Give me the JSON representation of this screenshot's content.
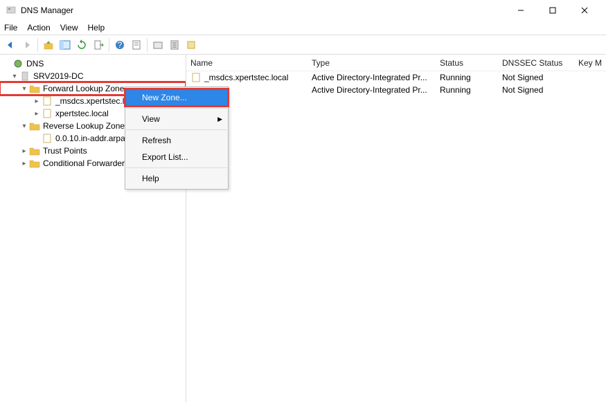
{
  "window": {
    "title": "DNS Manager"
  },
  "menu": {
    "file": "File",
    "action": "Action",
    "view": "View",
    "help": "Help"
  },
  "tree": {
    "root": "DNS",
    "server": "SRV2019-DC",
    "fwd": "Forward Lookup Zones",
    "fwd_children": {
      "z1": "_msdcs.xpertstec.local",
      "z2": "xpertstec.local"
    },
    "rev": "Reverse Lookup Zones",
    "rev_children": {
      "z1": "0.0.10.in-addr.arpa"
    },
    "trust": "Trust Points",
    "cond": "Conditional Forwarders"
  },
  "columns": {
    "name": "Name",
    "type": "Type",
    "status": "Status",
    "dnssec": "DNSSEC Status",
    "keym": "Key M"
  },
  "rows": [
    {
      "name": "_msdcs.xpertstec.local",
      "type": "Active Directory-Integrated Pr...",
      "status": "Running",
      "dnssec": "Not Signed"
    },
    {
      "name": "c.local",
      "type": "Active Directory-Integrated Pr...",
      "status": "Running",
      "dnssec": "Not Signed"
    }
  ],
  "context": {
    "new_zone": "New Zone...",
    "view": "View",
    "refresh": "Refresh",
    "export": "Export List...",
    "help": "Help"
  }
}
